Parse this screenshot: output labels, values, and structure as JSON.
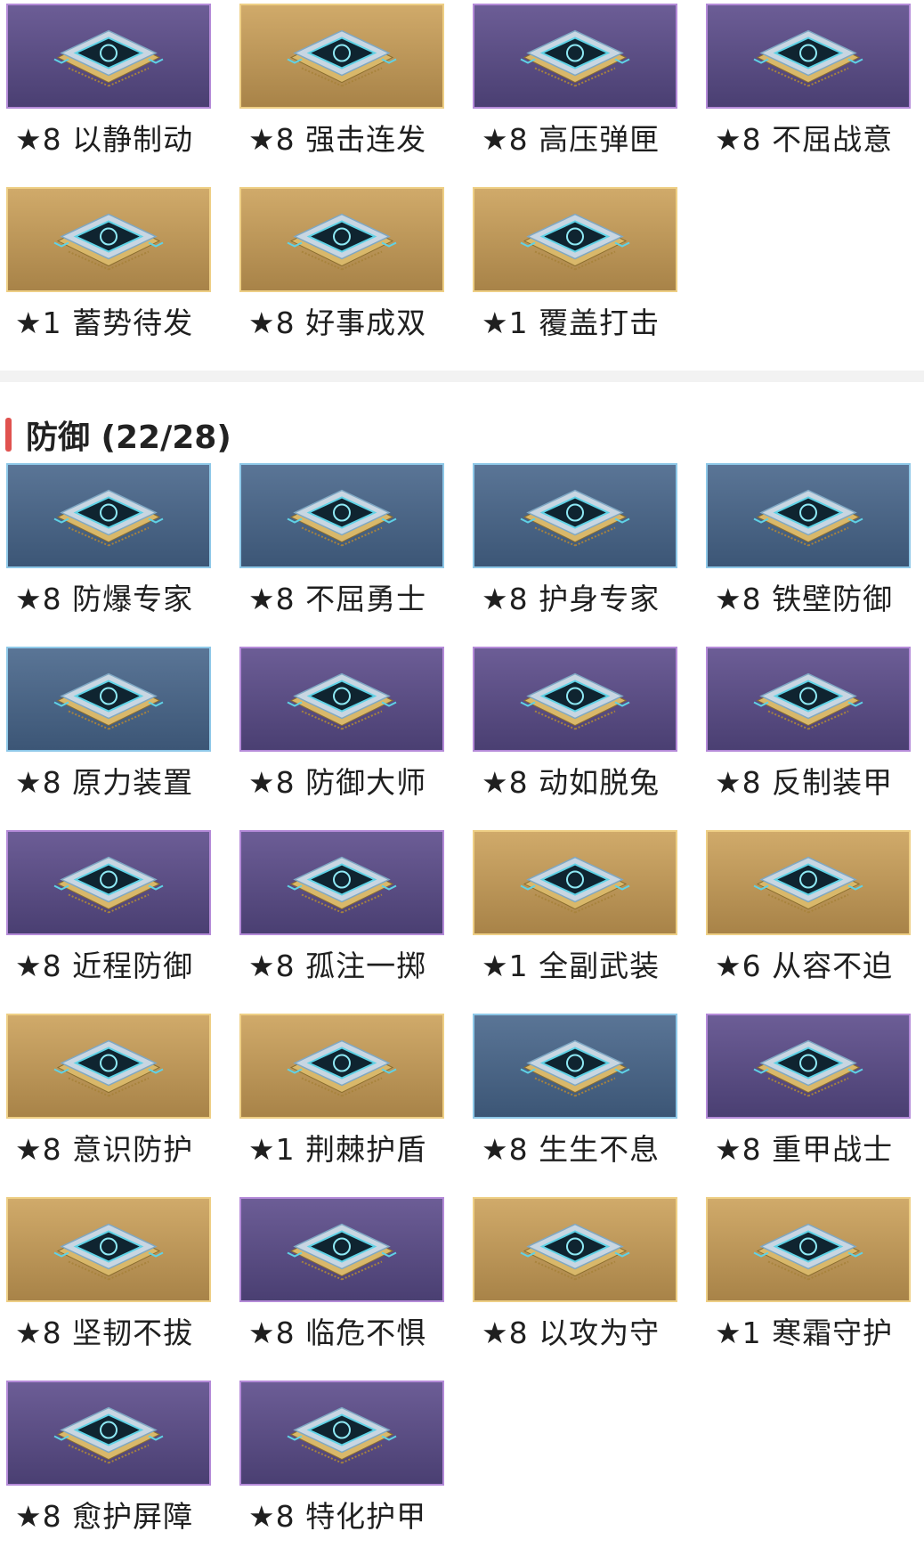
{
  "attack_items": [
    {
      "label": "★8 以静制动",
      "tier": "purple",
      "icon": "ornate-seal-icon"
    },
    {
      "label": "★8 强击连发",
      "tier": "gold",
      "icon": "claw-strike-icon"
    },
    {
      "label": "★8 高压弹匣",
      "tier": "purple",
      "icon": "rifle-magazine-icon"
    },
    {
      "label": "★8 不屈战意",
      "tier": "purple",
      "icon": "emblem-icon"
    },
    {
      "label": "★1 蓄势待发",
      "tier": "gold",
      "icon": "archer-icon"
    },
    {
      "label": "★8 好事成双",
      "tier": "gold",
      "icon": "double-arrow-icon"
    },
    {
      "label": "★1 覆盖打击",
      "tier": "gold",
      "icon": "soldier-icon"
    }
  ],
  "defense_section": {
    "title": "防御 (22/28)",
    "items": [
      {
        "label": "★8 防爆专家",
        "tier": "blue",
        "icon": "blast-shield-icon"
      },
      {
        "label": "★8 不屈勇士",
        "tier": "blue",
        "icon": "heart-ring-icon"
      },
      {
        "label": "★8 护身专家",
        "tier": "blue",
        "icon": "heart-icon"
      },
      {
        "label": "★8 铁壁防御",
        "tier": "blue",
        "icon": "barrier-icon"
      },
      {
        "label": "★8 原力装置",
        "tier": "blue",
        "icon": "force-device-icon"
      },
      {
        "label": "★8 防御大师",
        "tier": "purple",
        "icon": "helmet-icon"
      },
      {
        "label": "★8 动如脱兔",
        "tier": "purple",
        "icon": "dash-icon"
      },
      {
        "label": "★8 反制装甲",
        "tier": "purple",
        "icon": "armor-icon"
      },
      {
        "label": "★8 近程防御",
        "tier": "purple",
        "icon": "shield-hand-icon"
      },
      {
        "label": "★8 孤注一掷",
        "tier": "purple",
        "icon": "dice-icon"
      },
      {
        "label": "★1 全副武装",
        "tier": "gold",
        "icon": "full-gear-icon"
      },
      {
        "label": "★6 从容不迫",
        "tier": "gold",
        "icon": "calm-shield-icon"
      },
      {
        "label": "★8 意识防护",
        "tier": "gold",
        "icon": "mind-shield-icon"
      },
      {
        "label": "★1 荆棘护盾",
        "tier": "gold",
        "icon": "thorn-shield-icon"
      },
      {
        "label": "★8 生生不息",
        "tier": "blue",
        "icon": "regen-heart-icon"
      },
      {
        "label": "★8 重甲战士",
        "tier": "purple",
        "icon": "heavy-armor-icon"
      },
      {
        "label": "★8 坚韧不拔",
        "tier": "gold",
        "icon": "fist-icon"
      },
      {
        "label": "★8 临危不惧",
        "tier": "purple",
        "icon": "wing-shield-icon"
      },
      {
        "label": "★8 以攻为守",
        "tier": "gold",
        "icon": "counter-icon"
      },
      {
        "label": "★1 寒霜守护",
        "tier": "gold",
        "icon": "frost-shield-icon"
      },
      {
        "label": "★8 愈护屏障",
        "tier": "purple",
        "icon": "heal-barrier-icon"
      },
      {
        "label": "★8 特化护甲",
        "tier": "purple",
        "icon": "special-armor-icon"
      }
    ]
  },
  "colors": {
    "purple_tile": "#5a4d84",
    "gold_tile": "#bd9758",
    "blue_tile": "#4b6686",
    "accent_bar": "#e0524f"
  }
}
